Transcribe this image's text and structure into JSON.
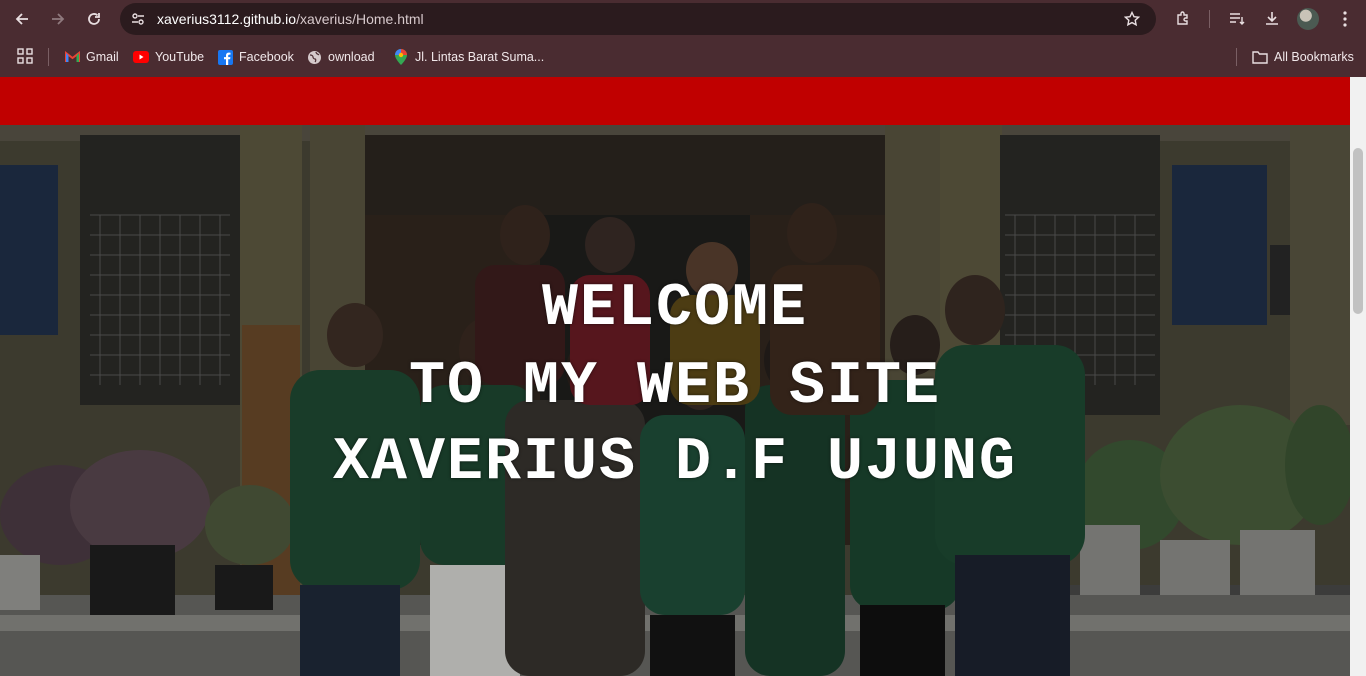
{
  "browser": {
    "url_host": "xaverius3112.github.io",
    "url_path": "/xaverius/Home.html",
    "bookmarks": [
      {
        "label": "Gmail",
        "icon": "gmail-icon"
      },
      {
        "label": "YouTube",
        "icon": "youtube-icon"
      },
      {
        "label": "Facebook",
        "icon": "facebook-icon"
      },
      {
        "label": "ownload",
        "icon": "globe-icon"
      },
      {
        "label": "Jl. Lintas Barat Suma...",
        "icon": "maps-pin-icon"
      }
    ],
    "all_bookmarks_label": "All Bookmarks"
  },
  "page": {
    "header_color": "#c00000",
    "hero": {
      "line1": "WELCOME",
      "line2": "TO MY WEB SITE",
      "line3": "XAVERIUS D.F UJUNG"
    }
  }
}
